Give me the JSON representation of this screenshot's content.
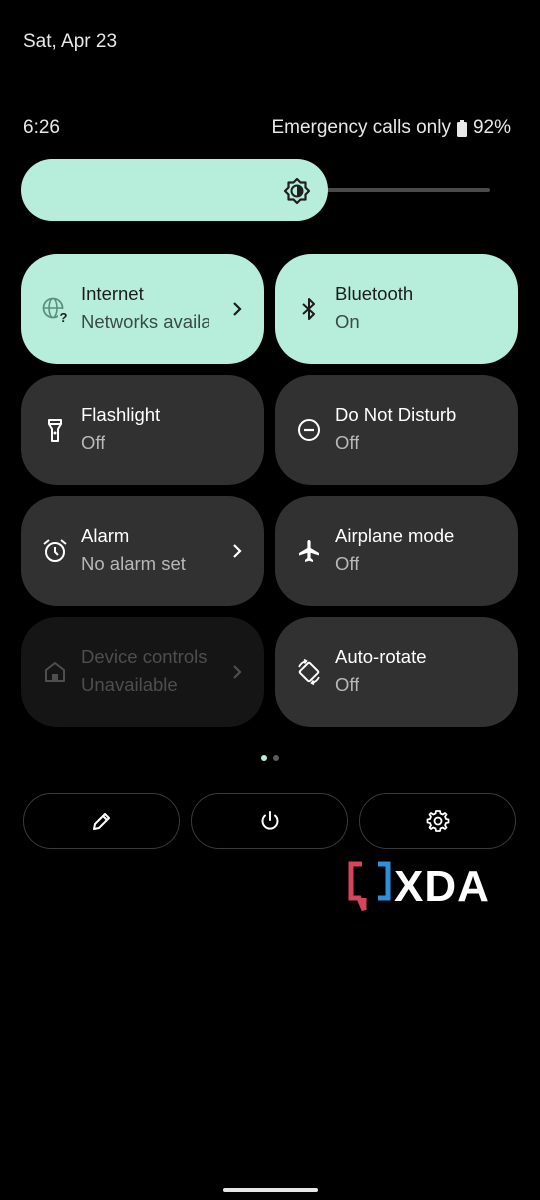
{
  "status": {
    "date": "Sat, Apr 23",
    "time": "6:26",
    "carrier": "Emergency calls only",
    "battery": "92%",
    "battery_icon": "battery-icon"
  },
  "brightness": {
    "icon": "brightness-icon",
    "level": 0.61
  },
  "tiles": [
    {
      "label": "Internet",
      "sub": "Networks available",
      "icon": "internet-question-icon",
      "state": "active",
      "chevron": true
    },
    {
      "label": "Bluetooth",
      "sub": "On",
      "icon": "bluetooth-icon",
      "state": "active",
      "chevron": false
    },
    {
      "label": "Flashlight",
      "sub": "Off",
      "icon": "flashlight-icon",
      "state": "off",
      "chevron": false
    },
    {
      "label": "Do Not Disturb",
      "sub": "Off",
      "icon": "do-not-disturb-icon",
      "state": "off",
      "chevron": false
    },
    {
      "label": "Alarm",
      "sub": "No alarm set",
      "icon": "alarm-icon",
      "state": "off",
      "chevron": true
    },
    {
      "label": "Airplane mode",
      "sub": "Off",
      "icon": "airplane-icon",
      "state": "off",
      "chevron": false
    },
    {
      "label": "Device controls",
      "sub": "Unavailable",
      "icon": "home-icon",
      "state": "disabled",
      "chevron": true
    },
    {
      "label": "Auto-rotate",
      "sub": "Off",
      "icon": "auto-rotate-icon",
      "state": "off",
      "chevron": false
    }
  ],
  "pager": {
    "pages": 2,
    "current": 1
  },
  "actions": [
    {
      "name": "edit",
      "icon": "pencil-icon"
    },
    {
      "name": "power",
      "icon": "power-icon"
    },
    {
      "name": "settings",
      "icon": "gear-icon"
    }
  ],
  "watermark": {
    "text": "XDA"
  },
  "colors": {
    "active_tile": "#b7eedb",
    "inactive_tile": "#313131",
    "disabled_tile": "#151515",
    "background": "#000000"
  }
}
